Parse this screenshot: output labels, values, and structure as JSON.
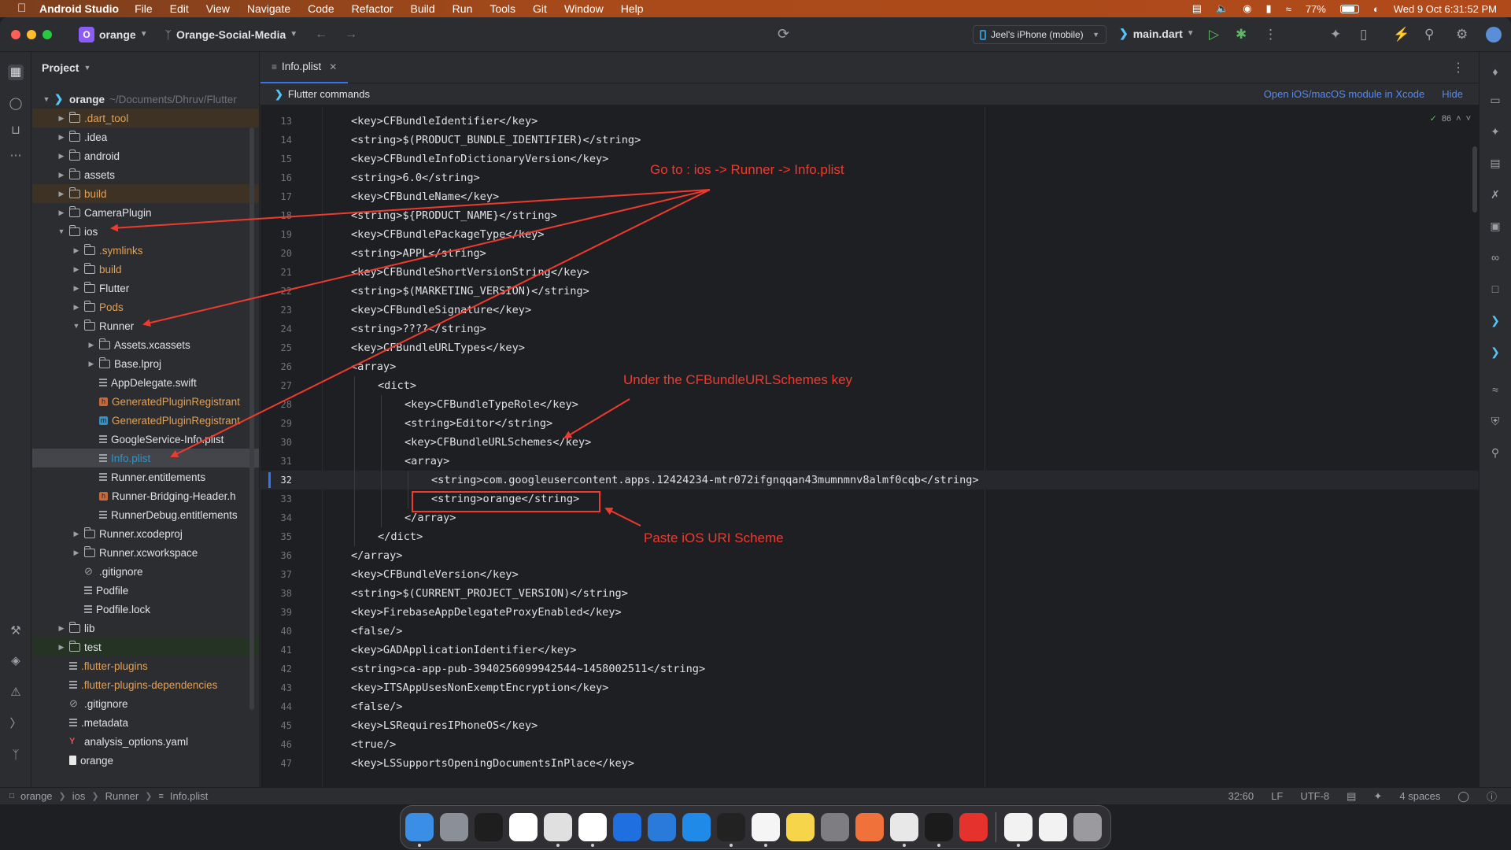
{
  "menubar": {
    "app_name": "Android Studio",
    "items": [
      "File",
      "Edit",
      "View",
      "Navigate",
      "Code",
      "Refactor",
      "Build",
      "Run",
      "Tools",
      "Git",
      "Window",
      "Help"
    ],
    "battery": "77%",
    "datetime": "Wed 9 Oct  6:31:52 PM"
  },
  "toolbar": {
    "project_badge": "O",
    "project_name": "orange",
    "vcs_branch": "Orange-Social-Media",
    "device": "Jeel's iPhone (mobile)",
    "run_config": "main.dart"
  },
  "project_panel": {
    "title": "Project",
    "root_path": "~/Documents/Dhruv/Flutter"
  },
  "tree": [
    {
      "label": "orange",
      "depth": 0,
      "open": true,
      "icon": "flutter",
      "style": "bold"
    },
    {
      "label": ".dart_tool",
      "depth": 1,
      "open": false,
      "icon": "folder",
      "style": "excluded"
    },
    {
      "label": ".idea",
      "depth": 1,
      "open": false,
      "icon": "folder",
      "style": ""
    },
    {
      "label": "android",
      "depth": 1,
      "open": false,
      "icon": "folder",
      "style": ""
    },
    {
      "label": "assets",
      "depth": 1,
      "open": false,
      "icon": "folder",
      "style": ""
    },
    {
      "label": "build",
      "depth": 1,
      "open": false,
      "icon": "folder",
      "style": "excluded"
    },
    {
      "label": "CameraPlugin",
      "depth": 1,
      "open": false,
      "icon": "folder",
      "style": ""
    },
    {
      "label": "ios",
      "depth": 1,
      "open": true,
      "icon": "folder",
      "style": ""
    },
    {
      "label": ".symlinks",
      "depth": 2,
      "open": false,
      "icon": "folder",
      "style": "orange"
    },
    {
      "label": "build",
      "depth": 2,
      "open": false,
      "icon": "folder",
      "style": "orange"
    },
    {
      "label": "Flutter",
      "depth": 2,
      "open": false,
      "icon": "folder",
      "style": ""
    },
    {
      "label": "Pods",
      "depth": 2,
      "open": false,
      "icon": "folder",
      "style": "orange"
    },
    {
      "label": "Runner",
      "depth": 2,
      "open": true,
      "icon": "folder",
      "style": ""
    },
    {
      "label": "Assets.xcassets",
      "depth": 3,
      "open": false,
      "icon": "folder",
      "style": ""
    },
    {
      "label": "Base.lproj",
      "depth": 3,
      "open": false,
      "icon": "folder",
      "style": ""
    },
    {
      "label": "AppDelegate.swift",
      "depth": 3,
      "open": null,
      "icon": "file",
      "style": ""
    },
    {
      "label": "GeneratedPluginRegistrant",
      "depth": 3,
      "open": null,
      "icon": "file-h",
      "style": "orange"
    },
    {
      "label": "GeneratedPluginRegistrant",
      "depth": 3,
      "open": null,
      "icon": "file-m",
      "style": "orange"
    },
    {
      "label": "GoogleService-Info.plist",
      "depth": 3,
      "open": null,
      "icon": "file",
      "style": ""
    },
    {
      "label": "Info.plist",
      "depth": 3,
      "open": null,
      "icon": "file",
      "style": "selected"
    },
    {
      "label": "Runner.entitlements",
      "depth": 3,
      "open": null,
      "icon": "file",
      "style": ""
    },
    {
      "label": "Runner-Bridging-Header.h",
      "depth": 3,
      "open": null,
      "icon": "file-h",
      "style": ""
    },
    {
      "label": "RunnerDebug.entitlements",
      "depth": 3,
      "open": null,
      "icon": "file",
      "style": ""
    },
    {
      "label": "Runner.xcodeproj",
      "depth": 2,
      "open": false,
      "icon": "folder",
      "style": ""
    },
    {
      "label": "Runner.xcworkspace",
      "depth": 2,
      "open": false,
      "icon": "folder",
      "style": ""
    },
    {
      "label": ".gitignore",
      "depth": 2,
      "open": null,
      "icon": "ignore",
      "style": ""
    },
    {
      "label": "Podfile",
      "depth": 2,
      "open": null,
      "icon": "file",
      "style": ""
    },
    {
      "label": "Podfile.lock",
      "depth": 2,
      "open": null,
      "icon": "file",
      "style": ""
    },
    {
      "label": "lib",
      "depth": 1,
      "open": false,
      "icon": "folder",
      "style": ""
    },
    {
      "label": "test",
      "depth": 1,
      "open": false,
      "icon": "folder",
      "style": "test"
    },
    {
      "label": ".flutter-plugins",
      "depth": 1,
      "open": null,
      "icon": "file",
      "style": "orange"
    },
    {
      "label": ".flutter-plugins-dependencies",
      "depth": 1,
      "open": null,
      "icon": "file",
      "style": "orange"
    },
    {
      "label": ".gitignore",
      "depth": 1,
      "open": null,
      "icon": "ignore",
      "style": ""
    },
    {
      "label": ".metadata",
      "depth": 1,
      "open": null,
      "icon": "file",
      "style": ""
    },
    {
      "label": "analysis_options.yaml",
      "depth": 1,
      "open": null,
      "icon": "yaml",
      "style": ""
    },
    {
      "label": "orange",
      "depth": 1,
      "open": null,
      "icon": "doc",
      "style": ""
    }
  ],
  "editor": {
    "tab_label": "Info.plist",
    "banner_title": "Flutter commands",
    "banner_link": "Open iOS/macOS module in Xcode",
    "banner_hide": "Hide",
    "inspection_count": "86",
    "lines": [
      {
        "n": "13",
        "indent": 1,
        "text": "<key>CFBundleIdentifier</key>"
      },
      {
        "n": "14",
        "indent": 1,
        "text": "<string>$(PRODUCT_BUNDLE_IDENTIFIER)</string>"
      },
      {
        "n": "15",
        "indent": 1,
        "text": "<key>CFBundleInfoDictionaryVersion</key>"
      },
      {
        "n": "16",
        "indent": 1,
        "text": "<string>6.0</string>"
      },
      {
        "n": "17",
        "indent": 1,
        "text": "<key>CFBundleName</key>"
      },
      {
        "n": "18",
        "indent": 1,
        "text": "<string>${PRODUCT_NAME}</string>"
      },
      {
        "n": "19",
        "indent": 1,
        "text": "<key>CFBundlePackageType</key>"
      },
      {
        "n": "20",
        "indent": 1,
        "text": "<string>APPL</string>"
      },
      {
        "n": "21",
        "indent": 1,
        "text": "<key>CFBundleShortVersionString</key>"
      },
      {
        "n": "22",
        "indent": 1,
        "text": "<string>$(MARKETING_VERSION)</string>"
      },
      {
        "n": "23",
        "indent": 1,
        "text": "<key>CFBundleSignature</key>"
      },
      {
        "n": "24",
        "indent": 1,
        "text": "<string>????</string>"
      },
      {
        "n": "25",
        "indent": 1,
        "text": "<key>CFBundleURLTypes</key>"
      },
      {
        "n": "26",
        "indent": 1,
        "text": "<array>"
      },
      {
        "n": "27",
        "indent": 2,
        "text": "<dict>"
      },
      {
        "n": "28",
        "indent": 3,
        "text": "<key>CFBundleTypeRole</key>"
      },
      {
        "n": "29",
        "indent": 3,
        "text": "<string>Editor</string>"
      },
      {
        "n": "30",
        "indent": 3,
        "text": "<key>CFBundleURLSchemes</key>"
      },
      {
        "n": "31",
        "indent": 3,
        "text": "<array>"
      },
      {
        "n": "32",
        "indent": 4,
        "text": "<string>com.googleusercontent.apps.12424234-mtr072ifgnqqan43mumnmnv8almf0cqb</string>"
      },
      {
        "n": "33",
        "indent": 4,
        "text": "<string>orange</string>"
      },
      {
        "n": "34",
        "indent": 3,
        "text": "</array>"
      },
      {
        "n": "35",
        "indent": 2,
        "text": "</dict>"
      },
      {
        "n": "36",
        "indent": 1,
        "text": "</array>"
      },
      {
        "n": "37",
        "indent": 1,
        "text": "<key>CFBundleVersion</key>"
      },
      {
        "n": "38",
        "indent": 1,
        "text": "<string>$(CURRENT_PROJECT_VERSION)</string>"
      },
      {
        "n": "39",
        "indent": 1,
        "text": "<key>FirebaseAppDelegateProxyEnabled</key>"
      },
      {
        "n": "40",
        "indent": 1,
        "text": "<false/>"
      },
      {
        "n": "41",
        "indent": 1,
        "text": "<key>GADApplicationIdentifier</key>"
      },
      {
        "n": "42",
        "indent": 1,
        "text": "<string>ca-app-pub-3940256099942544~1458002511</string>"
      },
      {
        "n": "43",
        "indent": 1,
        "text": "<key>ITSAppUsesNonExemptEncryption</key>"
      },
      {
        "n": "44",
        "indent": 1,
        "text": "<false/>"
      },
      {
        "n": "45",
        "indent": 1,
        "text": "<key>LSRequiresIPhoneOS</key>"
      },
      {
        "n": "46",
        "indent": 1,
        "text": "<true/>"
      },
      {
        "n": "47",
        "indent": 1,
        "text": "<key>LSSupportsOpeningDocumentsInPlace</key>"
      }
    ],
    "current_line": "32"
  },
  "annotations": {
    "goto": "Go to : ios -> Runner -> Info.plist",
    "under_key": "Under the CFBundleURLSchemes key",
    "paste": "Paste iOS URI Scheme"
  },
  "statusbar": {
    "breadcrumb": [
      "orange",
      "ios",
      "Runner",
      "Info.plist"
    ],
    "position": "32:60",
    "line_sep": "LF",
    "encoding": "UTF-8",
    "indent": "4 spaces"
  },
  "dock": [
    {
      "name": "Finder",
      "color": "#3a8ee6"
    },
    {
      "name": "Launchpad",
      "color": "#8a8f98"
    },
    {
      "name": "Figma",
      "color": "#1e1e1e"
    },
    {
      "name": "App Store",
      "color": "#ffffff"
    },
    {
      "name": "Chrome",
      "color": "#e0e0e0"
    },
    {
      "name": "Slack",
      "color": "#ffffff"
    },
    {
      "name": "App Store",
      "color": "#1f6fe0"
    },
    {
      "name": "Xcode",
      "color": "#2a7bd9"
    },
    {
      "name": "Safari",
      "color": "#1f8ae8"
    },
    {
      "name": "Terminal",
      "color": "#222222"
    },
    {
      "name": "Reminders",
      "color": "#f5f5f5"
    },
    {
      "name": "Notes",
      "color": "#f7d54a"
    },
    {
      "name": "System Settings",
      "color": "#7d7d82"
    },
    {
      "name": "Pages",
      "color": "#f0723a"
    },
    {
      "name": "Android Studio",
      "color": "#e8e8e8"
    },
    {
      "name": "Terminal",
      "color": "#1b1b1b"
    },
    {
      "name": "AnyDesk",
      "color": "#e5322d"
    },
    {
      "name": "Flutter",
      "color": "#f2f2f2"
    },
    {
      "name": "Preview",
      "color": "#f2f2f2"
    },
    {
      "name": "Trash",
      "color": "#9a9a9f"
    }
  ]
}
